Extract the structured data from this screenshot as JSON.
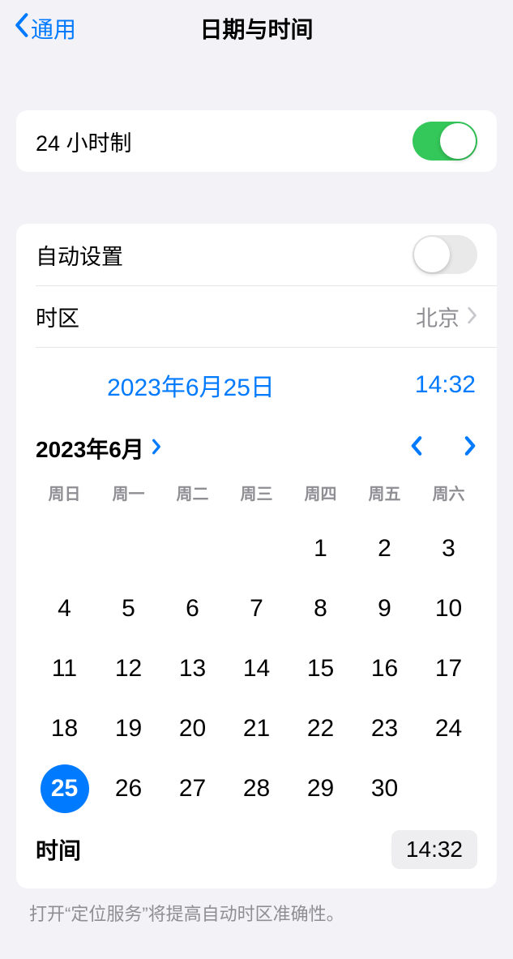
{
  "header": {
    "back": "通用",
    "title": "日期与时间"
  },
  "hour24": {
    "label": "24 小时制",
    "on": true
  },
  "auto": {
    "label": "自动设置",
    "on": false
  },
  "tz": {
    "label": "时区",
    "value": "北京"
  },
  "selected": {
    "date": "2023年6月25日",
    "time": "14:32"
  },
  "cal": {
    "month": "2023年6月",
    "weekdays": [
      "周日",
      "周一",
      "周二",
      "周三",
      "周四",
      "周五",
      "周六"
    ],
    "first_weekday": 4,
    "num_days": 30,
    "selected_day": 25
  },
  "time": {
    "label": "时间",
    "value": "14:32"
  },
  "footer": "打开“定位服务”将提高自动时区准确性。"
}
